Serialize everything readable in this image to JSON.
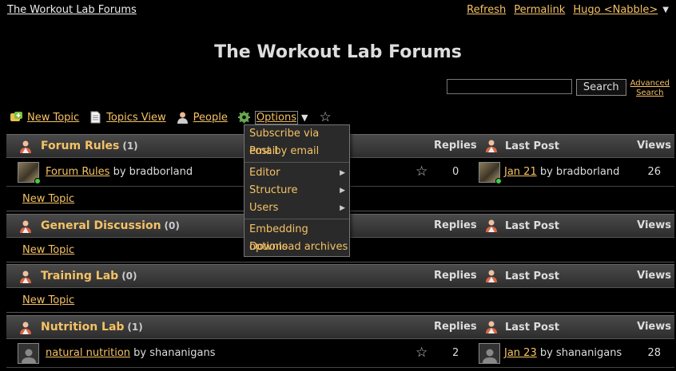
{
  "topbar": {
    "site_link": "The Workout Lab Forums",
    "refresh": "Refresh",
    "permalink": "Permalink",
    "user": "Hugo <Nabble>"
  },
  "title": "The Workout Lab Forums",
  "search": {
    "value": "",
    "button": "Search",
    "advanced_line1": "Advanced",
    "advanced_line2": "Search"
  },
  "toolbar": {
    "new_topic": "New Topic",
    "topics_view": "Topics View",
    "people": "People",
    "options": "Options"
  },
  "menu": {
    "subscribe": "Subscribe via email",
    "post_by_email": "Post by email",
    "editor": "Editor",
    "structure": "Structure",
    "users": "Users",
    "embedding": "Embedding options",
    "download": "Download archives"
  },
  "columns": {
    "replies": "Replies",
    "last_post": "Last Post",
    "views": "Views"
  },
  "forums": [
    {
      "name": "Forum Rules",
      "count": "(1)",
      "topic": {
        "title": "Forum Rules",
        "by": "by bradborland",
        "replies": "0",
        "last_date": "Jan 21",
        "last_by": "by bradborland",
        "views": "26"
      },
      "new_topic": "New Topic"
    },
    {
      "name": "General Discussion",
      "count": "(0)",
      "new_topic": "New Topic"
    },
    {
      "name": "Training Lab",
      "count": "(0)",
      "new_topic": "New Topic"
    },
    {
      "name": "Nutrition Lab",
      "count": "(1)",
      "topic": {
        "title": "natural nutrition",
        "by": "by shananigans",
        "replies": "2",
        "last_date": "Jan 23",
        "last_by": "by shananigans",
        "views": "28"
      }
    }
  ]
}
